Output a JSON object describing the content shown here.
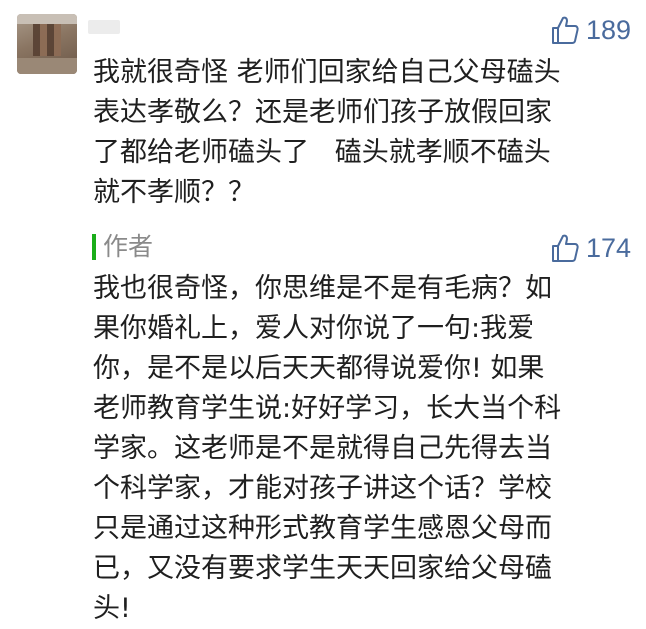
{
  "comment": {
    "likes": "189",
    "text": "我就很奇怪 老师们回家给自己父母磕头\n表达孝敬么？还是老师们孩子放假回家\n了都给老师磕头了   磕头就孝顺不磕头\n就不孝顺？？"
  },
  "reply": {
    "author_label": "作者",
    "likes": "174",
    "text": "我也很奇怪，你思维是不是有毛病？如\n果你婚礼上，爱人对你说了一句:我爱\n你，是不是以后天天都得说爱你! 如果\n老师教育学生说:好好学习，长大当个科\n学家。这老师是不是就得自己先得去当\n个科学家，才能对孩子讲这个话？学校\n只是通过这种形式教育学生感恩父母而\n已，又没有要求学生天天回家给父母磕\n头!"
  },
  "icons": {
    "like": "thumbs-up-outline-icon"
  },
  "colors": {
    "like": "#4a6b9d",
    "author_bar": "#1aad19",
    "author_label": "#8a8a8a",
    "text": "#1f1f1f"
  }
}
